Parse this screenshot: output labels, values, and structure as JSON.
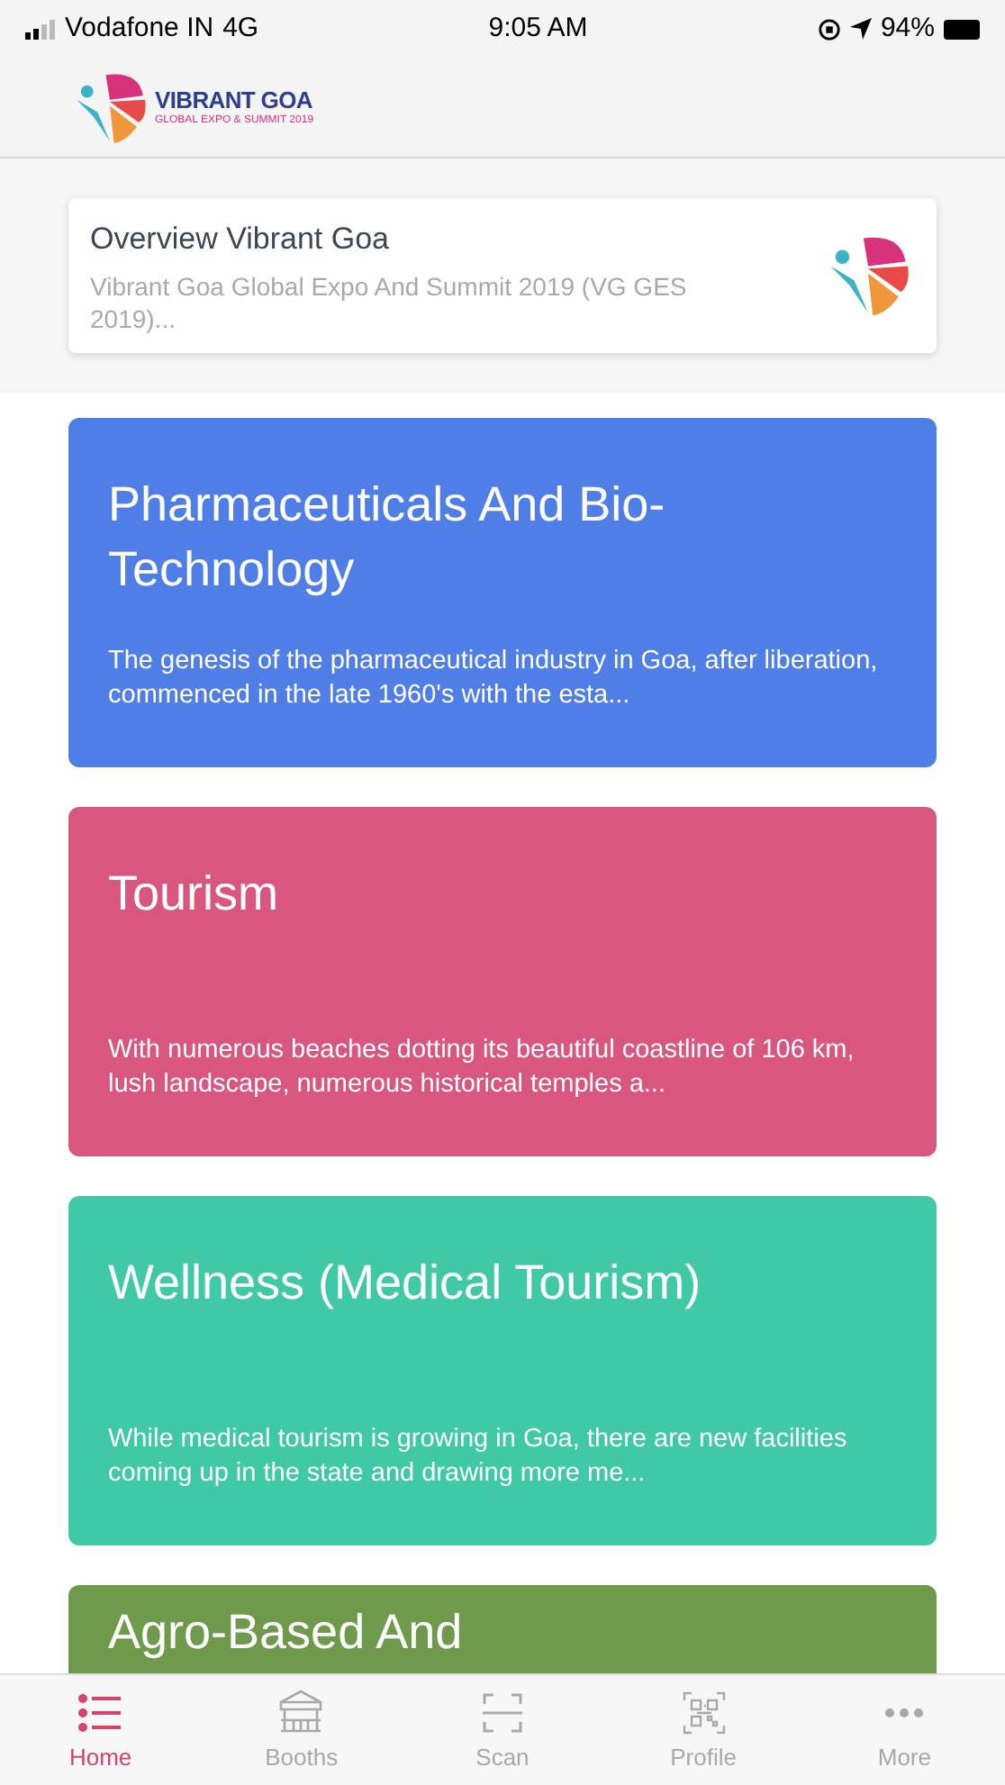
{
  "status_bar": {
    "carrier": "Vodafone IN",
    "network": "4G",
    "time": "9:05 AM",
    "battery": "94%"
  },
  "header": {
    "logo_title": "VIBRANT GOA",
    "logo_subtitle": "GLOBAL EXPO & SUMMIT 2019"
  },
  "overview": {
    "title": "Overview Vibrant Goa",
    "description": "Vibrant Goa Global Expo And Summit 2019 (VG GES 2019)..."
  },
  "sectors": [
    {
      "title": "Pharmaceuticals And Bio-Technology",
      "description": "The genesis of the pharmaceutical industry in Goa, after liberation, commenced in the late 1960's with the esta...",
      "color": "#4f7fe6"
    },
    {
      "title": "Tourism",
      "description": "With numerous beaches dotting its beautiful coastline of 106 km, lush landscape, numerous historical temples a...",
      "color": "#d9577f"
    },
    {
      "title": "Wellness (Medical Tourism)",
      "description": "While medical tourism is growing in Goa, there are new facilities coming up in the state and drawing more me...",
      "color": "#3fc9a5"
    },
    {
      "title": "Agro-Based And",
      "color": "#6f9a4c"
    }
  ],
  "tab_bar": [
    {
      "label": "Home",
      "kind": "list",
      "selected": true
    },
    {
      "label": "Booths",
      "kind": "booth",
      "selected": false
    },
    {
      "label": "Scan",
      "kind": "scan",
      "selected": false
    },
    {
      "label": "Profile",
      "kind": "qr",
      "selected": false
    },
    {
      "label": "More",
      "kind": "more",
      "selected": false
    }
  ]
}
